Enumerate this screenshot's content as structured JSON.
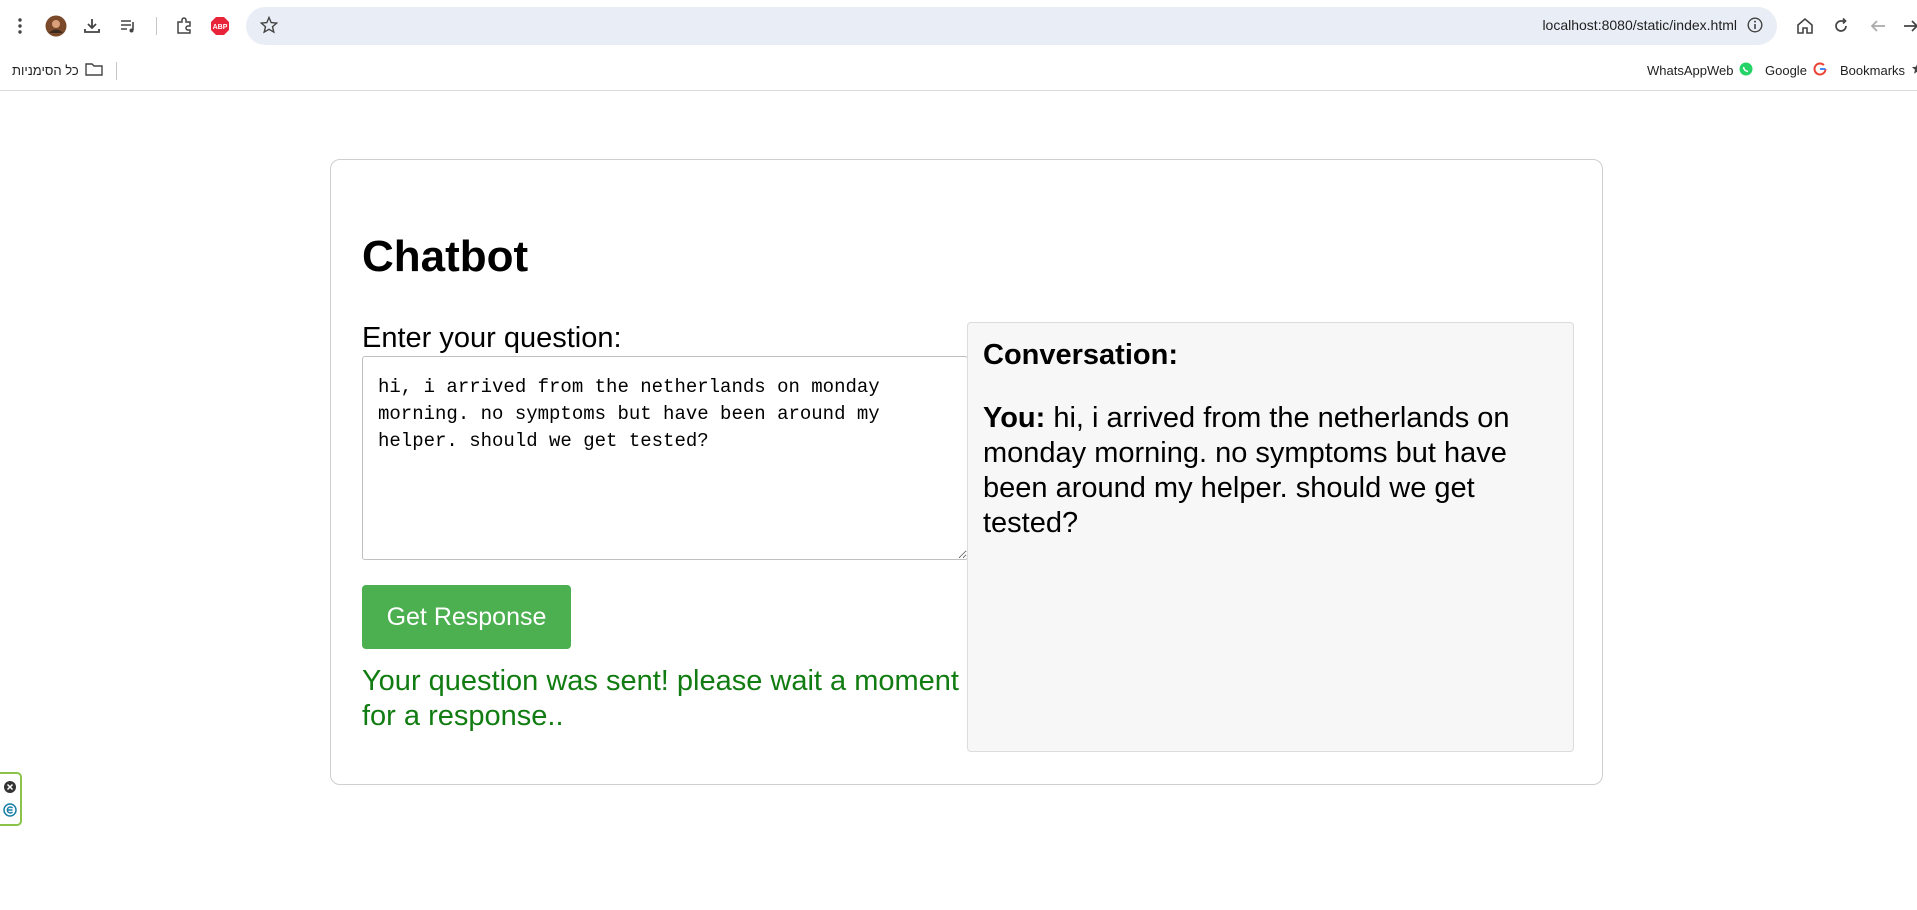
{
  "browser": {
    "url": "localhost:8080/static/index.html",
    "icons": [
      "menu-dots-icon",
      "profile-avatar-icon",
      "download-icon",
      "reading-list-icon",
      "extensions-icon",
      "adblock-icon",
      "star-icon",
      "info-icon",
      "home-icon",
      "reload-icon",
      "back-icon",
      "forward-icon"
    ],
    "adblock_label": "ABP"
  },
  "bookmarks": {
    "all_bookmarks": "כל הסימניות",
    "items": [
      {
        "label": "WhatsAppWeb",
        "icon": "whatsapp-icon"
      },
      {
        "label": "Google",
        "icon": "google-icon"
      },
      {
        "label": "Bookmarks",
        "icon": "star-icon"
      }
    ]
  },
  "page": {
    "title": "Chatbot",
    "question_label": "Enter your question:",
    "question_value": "hi, i arrived from the netherlands on monday morning. no symptoms but have been around my helper. should we get tested?",
    "button_label": "Get Response",
    "status_text": "Your question was sent! please wait a moment for a response..",
    "conversation": {
      "heading": "Conversation:",
      "messages": [
        {
          "speaker": "You:",
          "text": "hi, i arrived from the netherlands on monday morning. no symptoms but have been around my helper. should we get tested?"
        }
      ]
    }
  },
  "colors": {
    "button_bg": "#4caf50",
    "status_text": "#117c11",
    "conversation_bg": "#f7f7f7",
    "omnibox_bg": "#e9eef6"
  }
}
